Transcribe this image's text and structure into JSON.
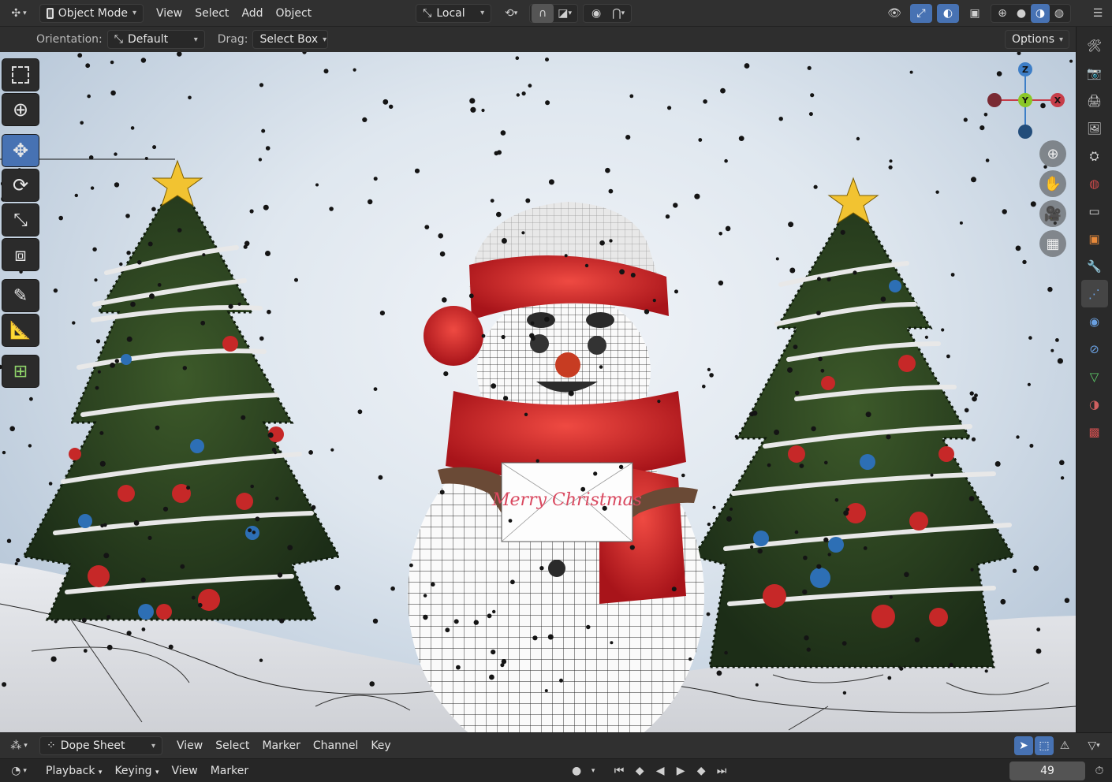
{
  "header": {
    "mode_label": "Object Mode",
    "menus": [
      "View",
      "Select",
      "Add",
      "Object"
    ],
    "transform_orientation": "Local"
  },
  "tool_header": {
    "orientation_label": "Orientation:",
    "orientation_value": "Default",
    "drag_label": "Drag:",
    "drag_value": "Select Box",
    "options_label": "Options"
  },
  "toolbar": {
    "tools": [
      "select-box",
      "cursor",
      "move",
      "rotate",
      "scale",
      "transform",
      "annotate",
      "measure",
      "add-cube"
    ],
    "active": "move"
  },
  "gizmo": {
    "axes": [
      "Z",
      "Y",
      "X"
    ]
  },
  "scene": {
    "card_text": "Merry Christmas"
  },
  "dope_sheet": {
    "editor_label": "Dope Sheet",
    "menus": [
      "View",
      "Select",
      "Marker",
      "Channel",
      "Key"
    ]
  },
  "timeline": {
    "menus": [
      "Playback",
      "Keying",
      "View",
      "Marker"
    ],
    "current_frame": "49"
  },
  "colors": {
    "accent": "#4772b3",
    "axis_x": "#c73d49",
    "axis_y": "#8bc727",
    "axis_z": "#3d7ec7",
    "panel": "#303030"
  }
}
